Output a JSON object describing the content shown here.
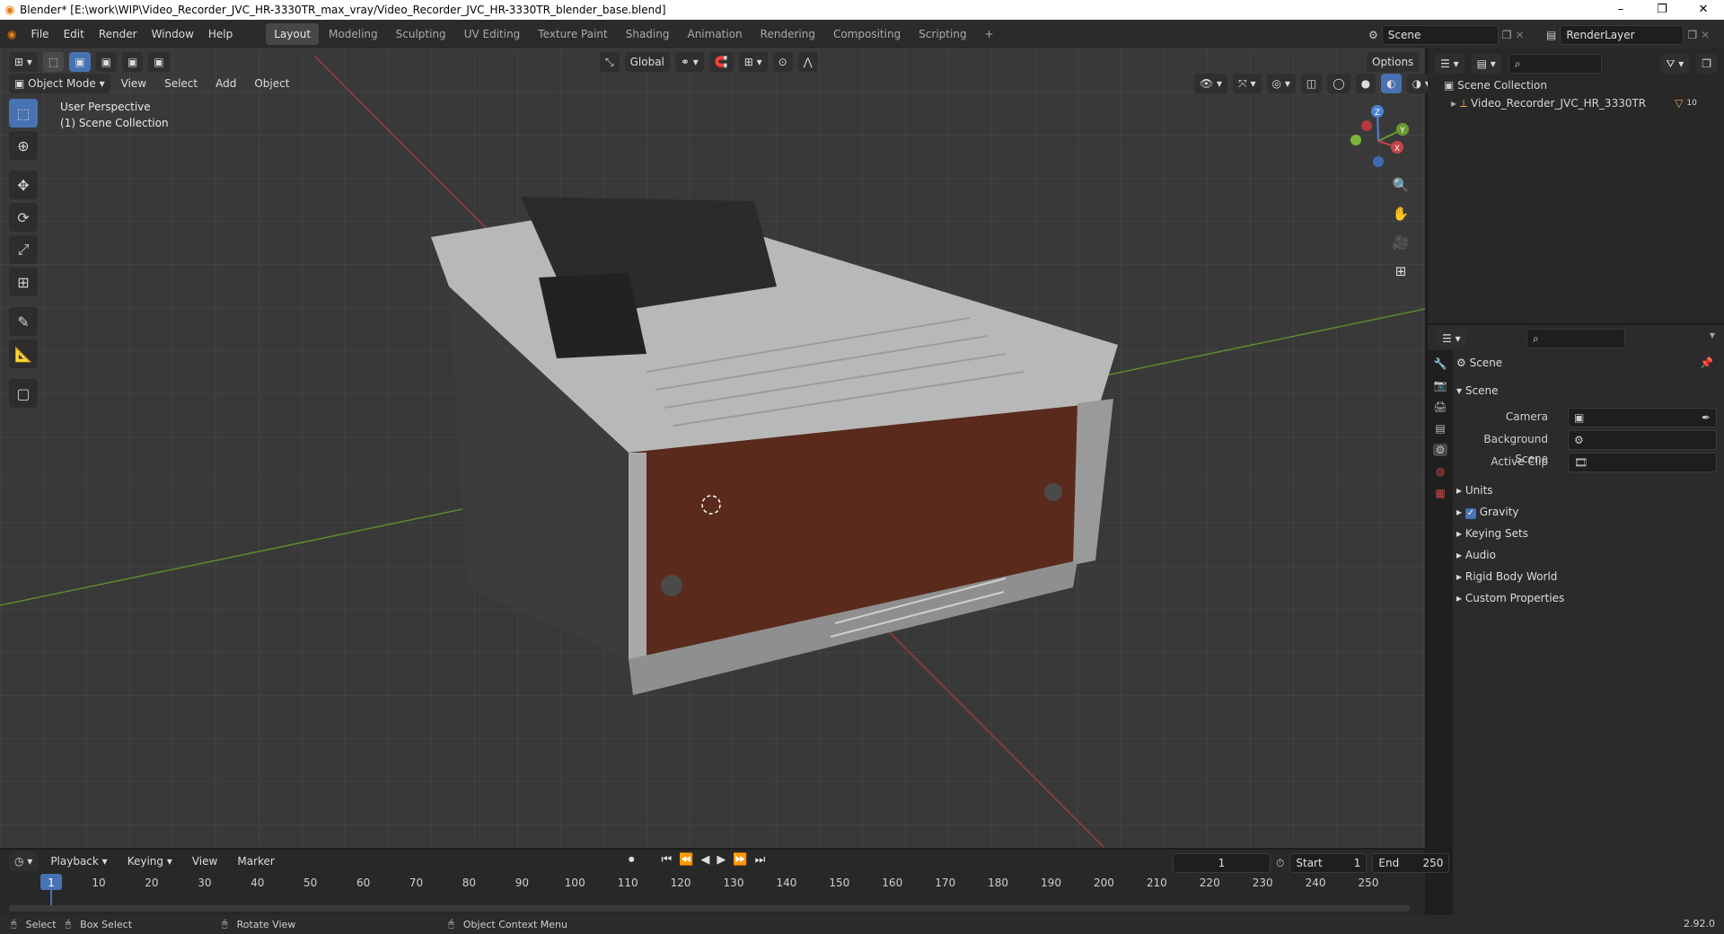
{
  "titlebar": {
    "title": "Blender* [E:\\work\\WIP\\Video_Recorder_JVC_HR-3330TR_max_vray/Video_Recorder_JVC_HR-3330TR_blender_base.blend]",
    "minimize": "–",
    "restore": "❐",
    "close": "✕"
  },
  "menu": {
    "items": [
      "File",
      "Edit",
      "Render",
      "Window",
      "Help"
    ]
  },
  "workspaces": {
    "tabs": [
      "Layout",
      "Modeling",
      "Sculpting",
      "UV Editing",
      "Texture Paint",
      "Shading",
      "Animation",
      "Rendering",
      "Compositing",
      "Scripting"
    ],
    "add": "+",
    "scene_value": "Scene",
    "render_layer_value": "RenderLayer"
  },
  "viewport_header": {
    "transform_orientation": "Global",
    "options": "Options",
    "mode": "Object Mode",
    "menus": [
      "View",
      "Select",
      "Add",
      "Object"
    ]
  },
  "viewport": {
    "perspective_label": "User Perspective",
    "collection_label": "(1) Scene Collection",
    "gizmo": {
      "z": "Z",
      "y": "Y",
      "x": "X"
    },
    "colors": {
      "x_axis": "#a8383c",
      "y_axis": "#6a9a30",
      "z_axis": "#4c83d6",
      "active_tool": "#4772b3"
    }
  },
  "outliner": {
    "root": "Scene Collection",
    "object": "Video_Recorder_JVC_HR_3330TR",
    "modifier_count": "10"
  },
  "properties": {
    "context_title": "Scene",
    "panel_title": "Scene",
    "fields": [
      {
        "label": "Camera",
        "value": ""
      },
      {
        "label": "Background Scene",
        "value": ""
      },
      {
        "label": "Active Clip",
        "value": ""
      }
    ],
    "subpanels": [
      "Units",
      "Gravity",
      "Keying Sets",
      "Audio",
      "Rigid Body World",
      "Custom Properties"
    ],
    "gravity_checked": true
  },
  "timeline": {
    "menus": [
      "Playback",
      "Keying",
      "View",
      "Marker"
    ],
    "current_frame": "1",
    "start_label": "Start",
    "start_value": "1",
    "end_label": "End",
    "end_value": "250",
    "ticks": [
      "1",
      "10",
      "20",
      "30",
      "40",
      "50",
      "60",
      "70",
      "80",
      "90",
      "100",
      "110",
      "120",
      "130",
      "140",
      "150",
      "160",
      "170",
      "180",
      "190",
      "200",
      "210",
      "220",
      "230",
      "240",
      "250"
    ]
  },
  "statusbar": {
    "select": "Select",
    "box_select": "Box Select",
    "rotate_view": "Rotate View",
    "context_menu": "Object Context Menu",
    "version": "2.92.0"
  }
}
